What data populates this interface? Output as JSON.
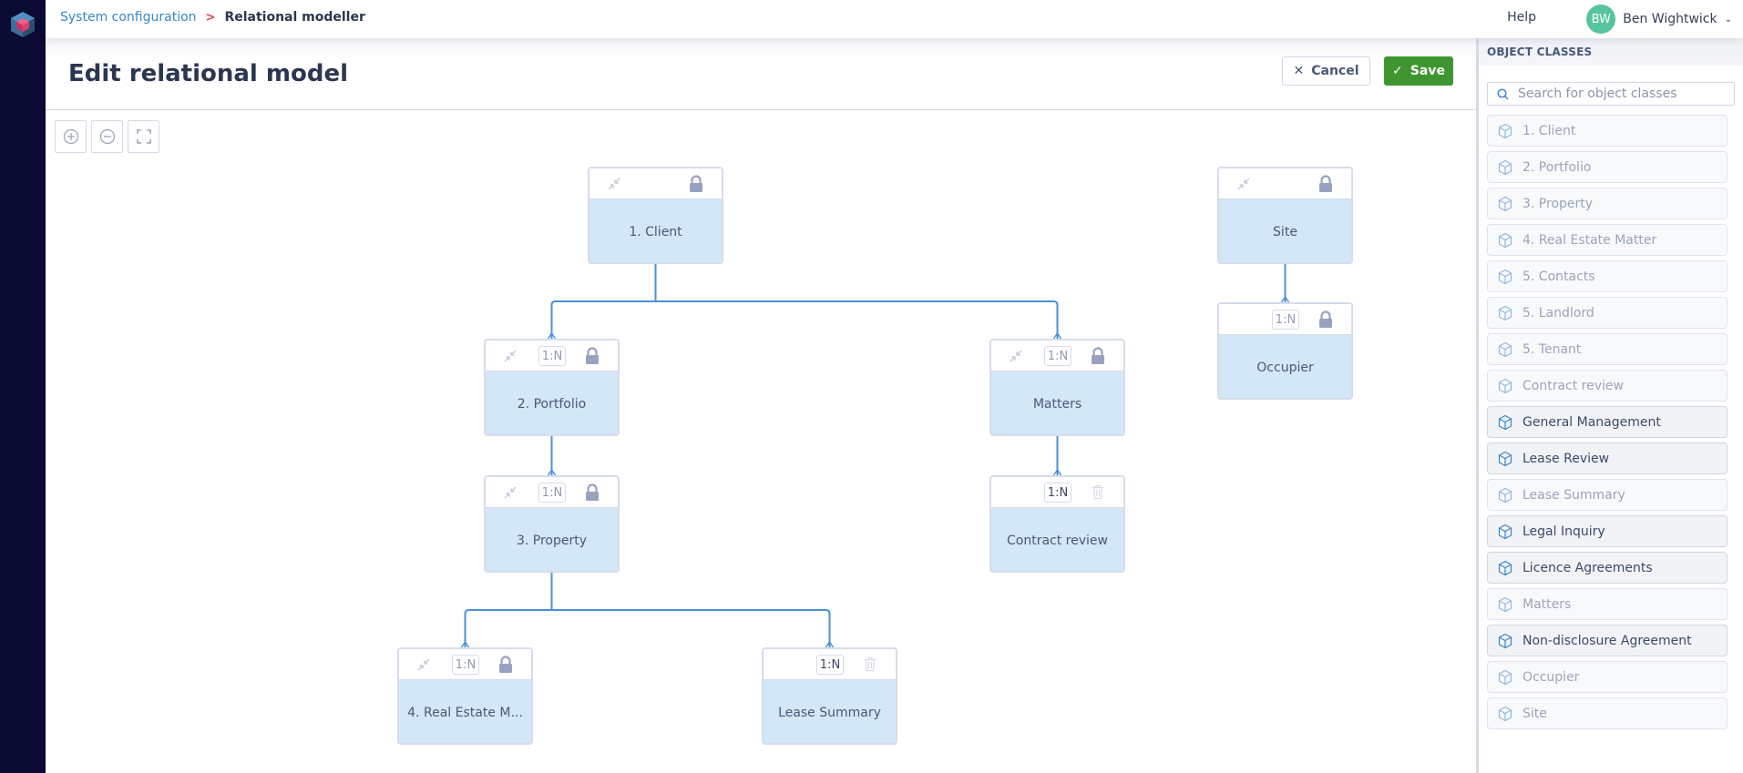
{
  "breadcrumb": {
    "parent": "System configuration",
    "separator": ">",
    "current": "Relational modeller"
  },
  "topbar": {
    "help": "Help",
    "user_initials": "BW",
    "user_name": "Ben Wightwick"
  },
  "page": {
    "title": "Edit relational model",
    "cancel_label": "Cancel",
    "save_label": "Save"
  },
  "colors": {
    "save": "#3f9631",
    "link": "#3a86c8",
    "node_body": "#d3e7f6",
    "connector": "#4a90d9",
    "nav": "#0b0a33",
    "avatar": "#56c59f"
  },
  "model": {
    "nodes": [
      {
        "id": "client",
        "label": "1. Client",
        "cardinality": null,
        "collapse": true,
        "locked": true
      },
      {
        "id": "site",
        "label": "Site",
        "cardinality": null,
        "collapse": true,
        "locked": true
      },
      {
        "id": "occupier",
        "label": "Occupier",
        "cardinality": "1:N",
        "collapse": false,
        "locked": true
      },
      {
        "id": "portfolio",
        "label": "2. Portfolio",
        "cardinality": "1:N",
        "collapse": true,
        "locked": true
      },
      {
        "id": "matters",
        "label": "Matters",
        "cardinality": "1:N",
        "collapse": true,
        "locked": true
      },
      {
        "id": "property",
        "label": "3. Property",
        "cardinality": "1:N",
        "collapse": true,
        "locked": true
      },
      {
        "id": "contract",
        "label": "Contract review",
        "cardinality": "1:N",
        "collapse": false,
        "locked": false
      },
      {
        "id": "rem",
        "label": "4. Real Estate M...",
        "cardinality": "1:N",
        "collapse": true,
        "locked": true
      },
      {
        "id": "lease",
        "label": "Lease Summary",
        "cardinality": "1:N",
        "collapse": false,
        "locked": false
      }
    ],
    "links": [
      {
        "from": "client",
        "to": "portfolio"
      },
      {
        "from": "client",
        "to": "matters"
      },
      {
        "from": "site",
        "to": "occupier"
      },
      {
        "from": "portfolio",
        "to": "property"
      },
      {
        "from": "matters",
        "to": "contract"
      },
      {
        "from": "property",
        "to": "rem"
      },
      {
        "from": "property",
        "to": "lease"
      }
    ]
  },
  "panel": {
    "title": "OBJECT CLASSES",
    "search_placeholder": "Search for object classes",
    "items": [
      {
        "label": "1. Client",
        "available": false
      },
      {
        "label": "2. Portfolio",
        "available": false
      },
      {
        "label": "3. Property",
        "available": false
      },
      {
        "label": "4. Real Estate Matter",
        "available": false
      },
      {
        "label": "5. Contacts",
        "available": false
      },
      {
        "label": "5. Landlord",
        "available": false
      },
      {
        "label": "5. Tenant",
        "available": false
      },
      {
        "label": "Contract review",
        "available": false
      },
      {
        "label": "General Management",
        "available": true
      },
      {
        "label": "Lease Review",
        "available": true
      },
      {
        "label": "Lease Summary",
        "available": false
      },
      {
        "label": "Legal Inquiry",
        "available": true
      },
      {
        "label": "Licence Agreements",
        "available": true
      },
      {
        "label": "Matters",
        "available": false
      },
      {
        "label": "Non-disclosure Agreement",
        "available": true
      },
      {
        "label": "Occupier",
        "available": false
      },
      {
        "label": "Site",
        "available": false
      }
    ]
  }
}
